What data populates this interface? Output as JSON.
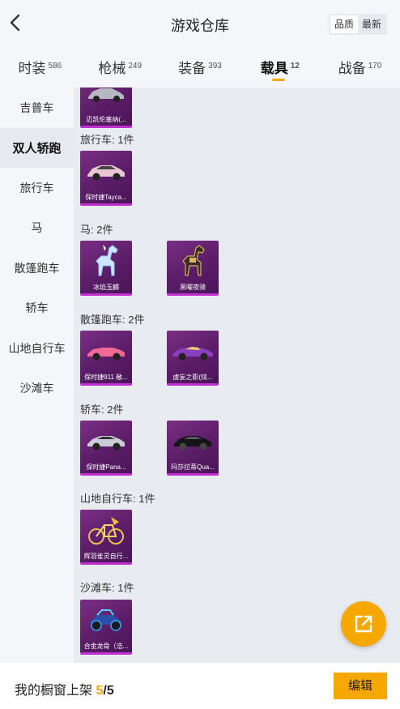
{
  "header": {
    "title": "游戏仓库",
    "sort_options": [
      "品质",
      "最新"
    ],
    "active_sort": "品质"
  },
  "tabs": [
    {
      "label": "时装",
      "count": "586",
      "active": false
    },
    {
      "label": "枪械",
      "count": "249",
      "active": false
    },
    {
      "label": "装备",
      "count": "393",
      "active": false
    },
    {
      "label": "载具",
      "count": "12",
      "active": true
    },
    {
      "label": "战备",
      "count": "170",
      "active": false
    }
  ],
  "sidebar": {
    "items": [
      {
        "label": "吉普车",
        "active": false
      },
      {
        "label": "双人轿跑",
        "active": true
      },
      {
        "label": "旅行车",
        "active": false
      },
      {
        "label": "马",
        "active": false
      },
      {
        "label": "散篷跑车",
        "active": false
      },
      {
        "label": "轿车",
        "active": false
      },
      {
        "label": "山地自行车",
        "active": false
      },
      {
        "label": "沙滩车",
        "active": false
      }
    ]
  },
  "content": {
    "partial_top_card": {
      "name": "迈凯伦塞纳(...",
      "icon": "car-icon"
    },
    "groups": [
      {
        "label": "旅行车: 1件",
        "items": [
          {
            "name": "保时捷Tayca...",
            "icon": "car-icon"
          }
        ]
      },
      {
        "label": "马: 2件",
        "items": [
          {
            "name": "冰焰玉麟",
            "icon": "horse-icon"
          },
          {
            "name": "黑曜夜骑",
            "icon": "horse-icon"
          }
        ]
      },
      {
        "label": "散篷跑车: 2件",
        "items": [
          {
            "name": "保时捷911 敞...",
            "icon": "car-icon"
          },
          {
            "name": "虚妄之影(炫...",
            "icon": "car-icon"
          }
        ]
      },
      {
        "label": "轿车: 2件",
        "items": [
          {
            "name": "保时捷Pana...",
            "icon": "car-icon"
          },
          {
            "name": "玛莎拉蒂Qua...",
            "icon": "car-icon"
          }
        ]
      },
      {
        "label": "山地自行车: 1件",
        "items": [
          {
            "name": "辉羽雀灵自行...",
            "icon": "bicycle-icon"
          }
        ]
      },
      {
        "label": "沙滩车: 1件",
        "items": [
          {
            "name": "合金龙骨（浩...",
            "icon": "buggy-icon"
          }
        ]
      }
    ]
  },
  "footer": {
    "showcase_label": "我的橱窗上架",
    "showcase_count": "5",
    "showcase_total": "/5",
    "edit_label": "编辑"
  },
  "colors": {
    "accent": "#f7a800",
    "card_purple": "#5a1d67",
    "card_border": "#c02fd0"
  }
}
